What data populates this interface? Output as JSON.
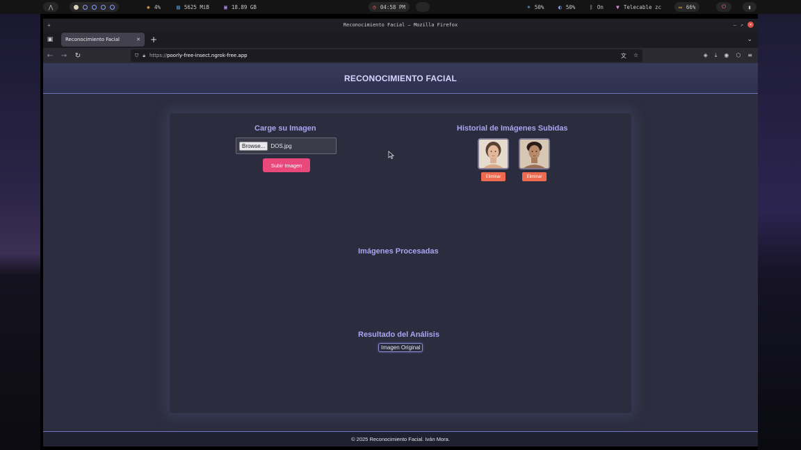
{
  "system_bar": {
    "cpu": "4%",
    "memory": "5625 MiB",
    "disk": "18.89 GB",
    "clock": "04:58 PM",
    "brightness": "50%",
    "volume": "50%",
    "bluetooth": "On",
    "network": "Telecable zc",
    "battery": "66%"
  },
  "window": {
    "title": "Reconocimiento Facial — Mozilla Firefox",
    "tab_label": "Reconocimiento Facial",
    "url_prefix": "https://",
    "url_host": "poorly-free-insect.ngrok-free.app"
  },
  "page": {
    "header_title": "RECONOCIMIENTO FACIAL",
    "upload": {
      "title": "Carge su Imagen",
      "browse_label": "Browse...",
      "file_name": "DOS.jpg",
      "submit_label": "Subir Imagen"
    },
    "history": {
      "title": "Historial de Imágenes Subidas",
      "items": [
        {
          "delete_label": "Eliminar"
        },
        {
          "delete_label": "Eliminar"
        }
      ]
    },
    "processed_title": "Imágenes Procesadas",
    "analysis": {
      "title": "Resultado del Análisis",
      "tag": "Imagen Original"
    },
    "footer": "© 2025 Reconocimiento Facial. Iván Mora."
  },
  "colors": {
    "accent": "#a9a6f2",
    "submit": "#e9487d",
    "delete": "#ef6a4e"
  }
}
